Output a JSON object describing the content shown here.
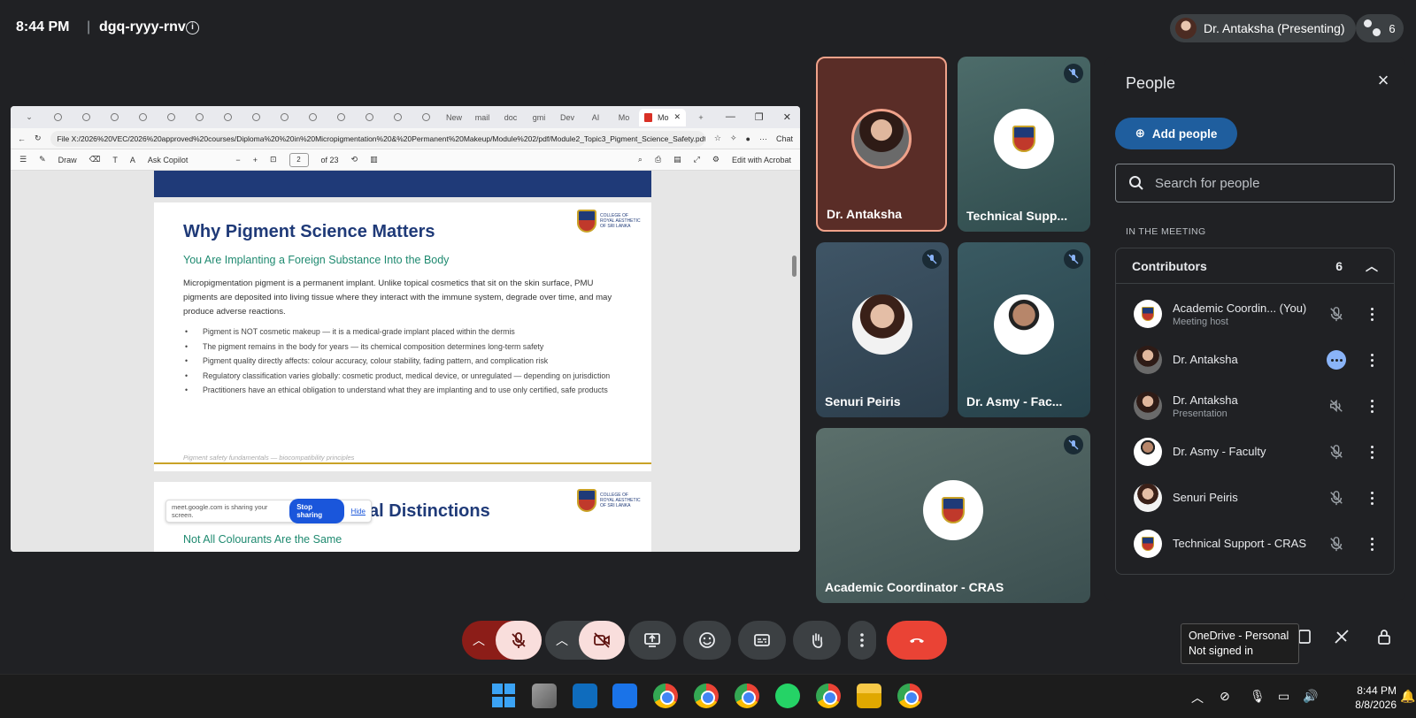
{
  "meeting": {
    "time": "8:44 PM",
    "separator": "|",
    "code": "dgq-ryyy-rnv",
    "presenting_label": "Dr. Antaksha (Presenting)",
    "participant_count": "6"
  },
  "share": {
    "address": "File   X:/2026%20VEC/2026%20approved%20courses/Diploma%20%20in%20Micropigmentation%20&%20Permanent%20Makeup/Module%202/pdf/Module2_Topic3_Pigment_Science_Safety.pdf",
    "toolbar": {
      "draw": "Draw",
      "ask_copilot": "Ask Copilot",
      "page_current": "2",
      "page_total": "of 23",
      "edit_acrobat": "Edit with Acrobat",
      "chat": "Chat"
    },
    "tab_labels": [
      "New",
      "mail",
      "doc",
      "gmi",
      "Dev",
      "AI",
      "Mo",
      "Mo"
    ],
    "page1": {
      "title": "Why Pigment Science Matters",
      "subtitle": "You Are Implanting a Foreign Substance Into the Body",
      "paragraph": "Micropigmentation pigment is a permanent implant. Unlike topical cosmetics that sit on the skin surface, PMU pigments are deposited into living tissue where they interact with the immune system, degrade over time, and may produce adverse reactions.",
      "bullets": [
        "Pigment is NOT cosmetic makeup — it is a medical-grade implant placed within the dermis",
        "The pigment remains in the body for years — its chemical composition determines long-term safety",
        "Pigment quality directly affects: colour accuracy, colour stability, fading pattern, and complication risk",
        "Regulatory classification varies globally: cosmetic product, medical device, or unregulated — depending on jurisdiction",
        "Practitioners have an ethical obligation to understand what they are implanting and to use only certified, safe products"
      ],
      "footer": "Pigment safety fundamentals — biocompatibility principles",
      "crest_text": "COLLEGE OF ROYAL AESTHETIC OF SRI LANKA"
    },
    "page2": {
      "title": "Pigment vs. Ink: Critical Distinctions",
      "subtitle": "Not All Colourants Are the Same"
    },
    "notice": {
      "text": "meet.google.com is sharing your screen.",
      "stop": "Stop sharing",
      "hide": "Hide"
    }
  },
  "tiles": [
    {
      "name": "Dr. Antaksha"
    },
    {
      "name": "Technical Supp..."
    },
    {
      "name": "Senuri Peiris"
    },
    {
      "name": "Dr. Asmy - Fac..."
    },
    {
      "name": "Academic Coordinator - CRAS"
    }
  ],
  "panel": {
    "title": "People",
    "add_people": "Add people",
    "search_placeholder": "Search for people",
    "section": "IN THE MEETING",
    "contributors_label": "Contributors",
    "contributors_count": "6",
    "people": [
      {
        "name": "Academic Coordin...  (You)",
        "sub": "Meeting host"
      },
      {
        "name": "Dr. Antaksha",
        "sub": ""
      },
      {
        "name": "Dr. Antaksha",
        "sub": "Presentation"
      },
      {
        "name": "Dr. Asmy - Faculty",
        "sub": ""
      },
      {
        "name": "Senuri Peiris",
        "sub": ""
      },
      {
        "name": "Technical Support - CRAS",
        "sub": ""
      }
    ]
  },
  "tooltip": {
    "line1": "OneDrive - Personal",
    "line2": "Not signed in"
  },
  "taskbar": {
    "time": "8:44 PM",
    "date": "8/8/2026"
  },
  "colors": {
    "accent_blue": "#1f5e9e",
    "end_call_red": "#ea4335",
    "muted_pink": "#f9dedc"
  }
}
